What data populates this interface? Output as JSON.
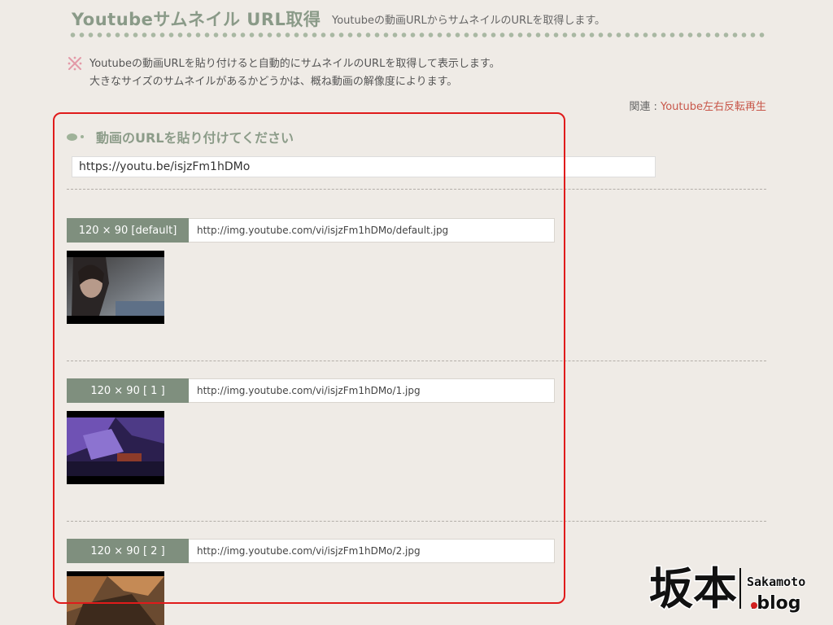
{
  "header": {
    "title": "Youtubeサムネイル URL取得",
    "description": "Youtubeの動画URLからサムネイルのURLを取得します。"
  },
  "note": {
    "icon": "asterisk-icon",
    "line1": "Youtubeの動画URLを貼り付けると自動的にサムネイルのURLを取得して表示します。",
    "line2": "大きなサイズのサムネイルがあるかどうかは、概ね動画の解像度によります。"
  },
  "related": {
    "label": "関連 : ",
    "link": "Youtube左右反転再生"
  },
  "section": {
    "title": "動画のURLを貼り付けてください"
  },
  "input": {
    "value": "https://youtu.be/isjzFm1hDMo"
  },
  "thumbnails": [
    {
      "label": "120 × 90 [default]",
      "url": "http://img.youtube.com/vi/isjzFm1hDMo/default.jpg"
    },
    {
      "label": "120 × 90 [ 1 ]",
      "url": "http://img.youtube.com/vi/isjzFm1hDMo/1.jpg"
    },
    {
      "label": "120 × 90 [ 2 ]",
      "url": "http://img.youtube.com/vi/isjzFm1hDMo/2.jpg"
    }
  ],
  "watermark": {
    "kanji": "坂本",
    "name": "Sakamoto",
    "blog": ".blog"
  },
  "colors": {
    "background": "#efebe6",
    "accent_green": "#8a9a88",
    "label_green": "#7f8f7e",
    "link_red": "#c8574a",
    "highlight_red": "#e01b1b"
  }
}
